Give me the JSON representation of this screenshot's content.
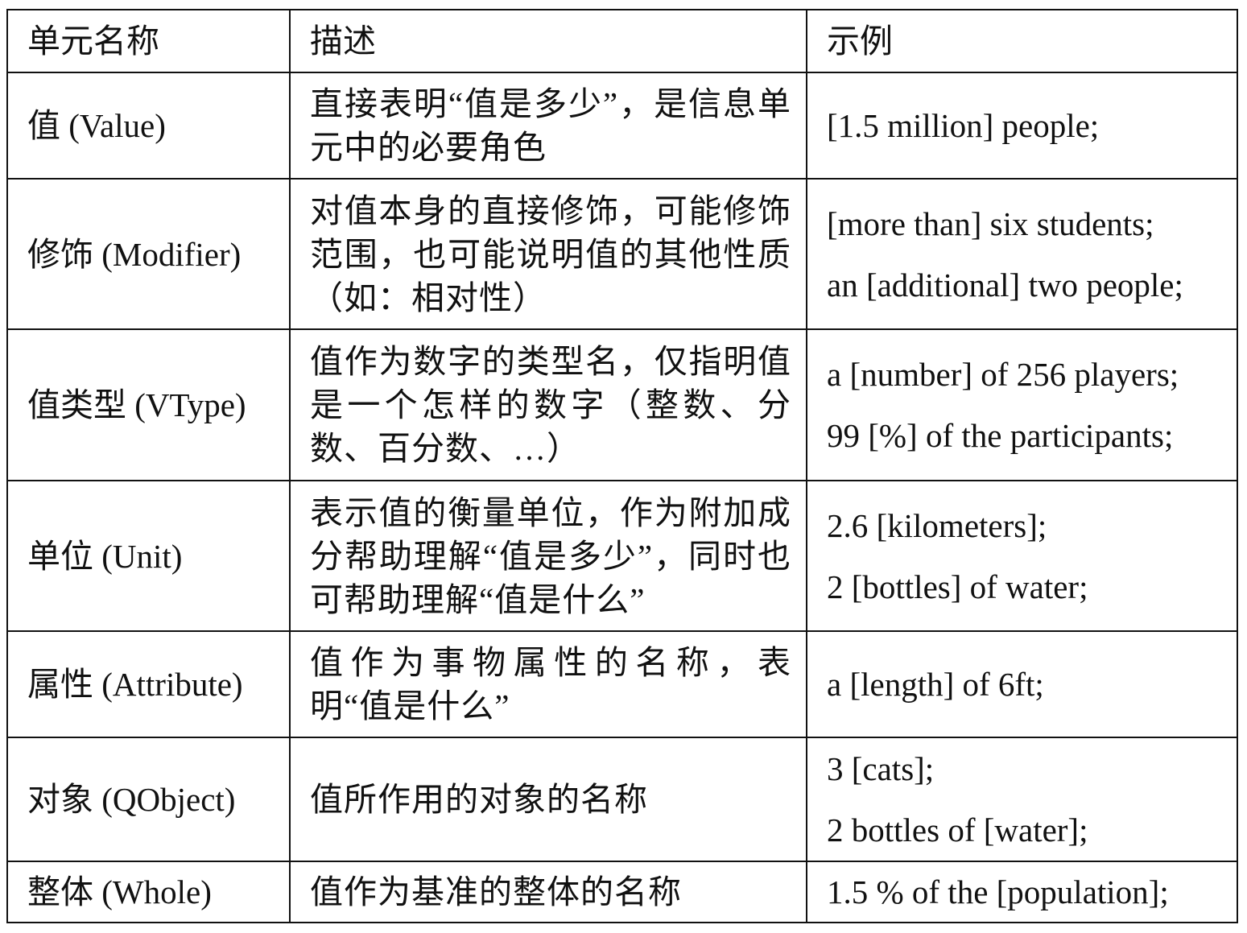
{
  "header": {
    "col_name": "单元名称",
    "col_desc": "描述",
    "col_example": "示例"
  },
  "rows": [
    {
      "name": "值 (Value)",
      "desc": "直接表明“值是多少”，是信息单元中的必要角色",
      "examples": [
        "[1.5 million] people;"
      ]
    },
    {
      "name": "修饰 (Modifier)",
      "desc": "对值本身的直接修饰，可能修饰范围，也可能说明值的其他性质（如：相对性）",
      "examples": [
        "[more than] six students;",
        "an [additional] two people;"
      ]
    },
    {
      "name": "值类型 (VType)",
      "desc": "值作为数字的类型名，仅指明值是一个怎样的数字（整数、分数、百分数、…）",
      "examples": [
        "a [number] of 256 players;",
        "99 [%] of the participants;"
      ]
    },
    {
      "name": "单位 (Unit)",
      "desc": "表示值的衡量单位，作为附加成分帮助理解“值是多少”，同时也可帮助理解“值是什么”",
      "examples": [
        "2.6 [kilometers];",
        "2 [bottles] of water;"
      ]
    },
    {
      "name": "属性 (Attribute)",
      "desc": "值作为事物属性的名称，表明“值是什么”",
      "examples": [
        "a [length] of 6ft;"
      ]
    },
    {
      "name": "对象 (QObject)",
      "desc": "值所作用的对象的名称",
      "examples": [
        "3 [cats];",
        "2 bottles of [water];"
      ]
    },
    {
      "name": "整体 (Whole)",
      "desc": "值作为基准的整体的名称",
      "examples": [
        "1.5 % of the [population];"
      ]
    }
  ]
}
